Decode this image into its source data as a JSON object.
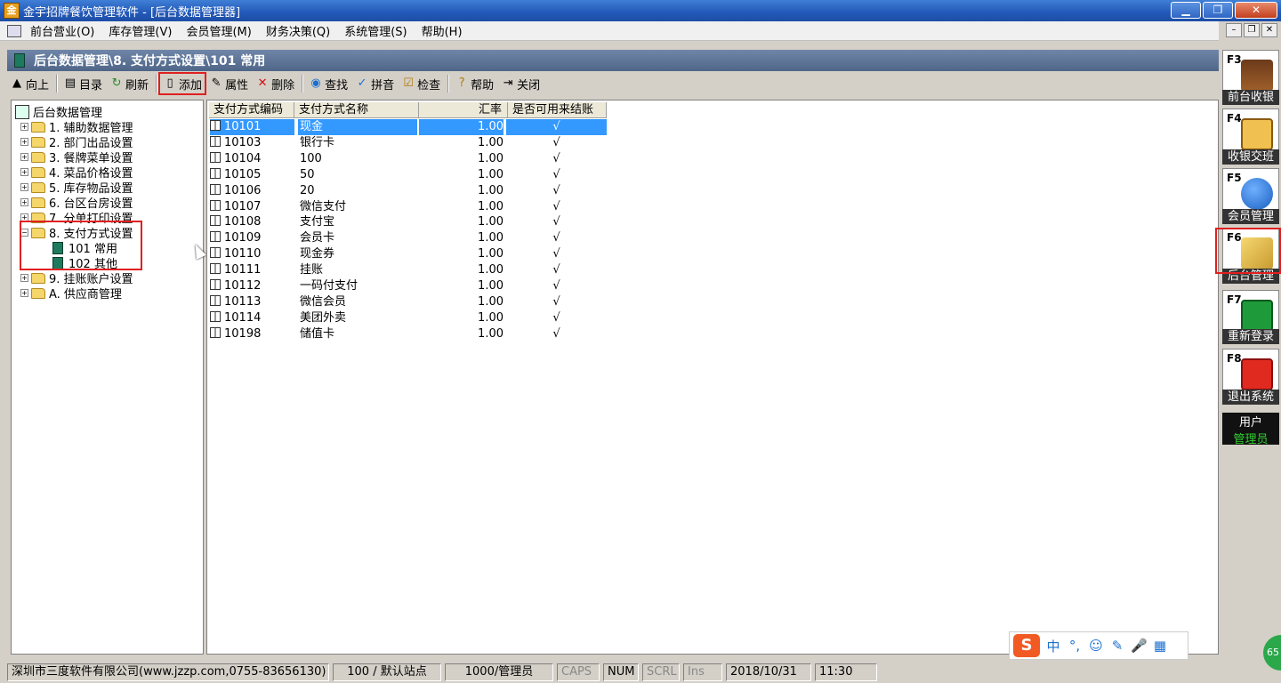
{
  "window": {
    "app_icon_text": "金",
    "title": "金宇招牌餐饮管理软件 - [后台数据管理器]",
    "min_label": "▁",
    "max_label": "❐",
    "close_label": "✕"
  },
  "menu": {
    "items": [
      "前台营业(O)",
      "库存管理(V)",
      "会员管理(M)",
      "财务决策(Q)",
      "系统管理(S)",
      "帮助(H)"
    ],
    "mdi_buttons": [
      "–",
      "❐",
      "✕"
    ]
  },
  "path": {
    "text": "后台数据管理\\8. 支付方式设置\\101 常用"
  },
  "toolbar": {
    "up": "向上",
    "dir": "目录",
    "refresh": "刷新",
    "add": "添加",
    "props": "属性",
    "delete": "删除",
    "find": "查找",
    "pinyin": "拼音",
    "check": "检查",
    "help": "帮助",
    "close": "关闭",
    "up_icon": "▲",
    "dir_icon": "▤",
    "refresh_icon": "↻",
    "add_icon": "▯",
    "props_icon": "✎",
    "delete_icon": "✕",
    "find_icon": "◉",
    "pinyin_icon": "✓",
    "check_icon": "☑",
    "help_icon": "?",
    "close_icon": "⇥"
  },
  "tree": {
    "root": "后台数据管理",
    "nodes": [
      "1. 辅助数据管理",
      "2. 部门出品设置",
      "3. 餐牌菜单设置",
      "4. 菜品价格设置",
      "5. 库存物品设置",
      "6. 台区台房设置",
      "7. 分单打印设置",
      "8. 支付方式设置",
      "9. 挂账账户设置",
      "A. 供应商管理"
    ],
    "children": [
      "101 常用",
      "102 其他"
    ],
    "collapsed_sign": "+",
    "expanded_sign": "−"
  },
  "grid": {
    "columns": [
      "支付方式编码",
      "支付方式名称",
      "汇率",
      "是否可用来结账"
    ],
    "rows": [
      [
        "10101",
        "现金",
        "1.00",
        "√"
      ],
      [
        "10103",
        "银行卡",
        "1.00",
        "√"
      ],
      [
        "10104",
        "100",
        "1.00",
        "√"
      ],
      [
        "10105",
        "50",
        "1.00",
        "√"
      ],
      [
        "10106",
        "20",
        "1.00",
        "√"
      ],
      [
        "10107",
        "微信支付",
        "1.00",
        "√"
      ],
      [
        "10108",
        "支付宝",
        "1.00",
        "√"
      ],
      [
        "10109",
        "会员卡",
        "1.00",
        "√"
      ],
      [
        "10110",
        "现金券",
        "1.00",
        "√"
      ],
      [
        "10111",
        "挂账",
        "1.00",
        "√"
      ],
      [
        "10112",
        "一码付支付",
        "1.00",
        "√"
      ],
      [
        "10113",
        "微信会员",
        "1.00",
        "√"
      ],
      [
        "10114",
        "美团外卖",
        "1.00",
        "√"
      ],
      [
        "10198",
        "储值卡",
        "1.00",
        "√"
      ]
    ]
  },
  "side": {
    "keys": [
      {
        "key": "F3",
        "label": "前台收银",
        "icon": "dining-table-icon",
        "color": "#ffffff"
      },
      {
        "key": "F4",
        "label": "收银交班",
        "icon": "clipboard-check-icon",
        "color": "#ffffff"
      },
      {
        "key": "F5",
        "label": "会员管理",
        "icon": "members-icon",
        "color": "#ffffff"
      },
      {
        "key": "F6",
        "label": "后台管理",
        "icon": "tools-folder-icon",
        "color": "#ffffff"
      },
      {
        "key": "F7",
        "label": "重新登录",
        "icon": "hourglass-icon",
        "color": "#ffffff"
      },
      {
        "key": "F8",
        "label": "退出系统",
        "icon": "power-icon",
        "color": "#ffffff"
      }
    ],
    "user_title": "用户",
    "user_name": "管理员"
  },
  "ime": {
    "logo": "S",
    "items": [
      "中",
      "°,",
      "☺",
      "✎",
      "🎤",
      "▦"
    ]
  },
  "status": {
    "company": "深圳市三度软件有限公司(www.jzzp.com,0755-83656130)",
    "station": "100 / 默认站点",
    "operator": "1000/管理员",
    "caps": "CAPS",
    "num": "NUM",
    "scrl": "SCRL",
    "ins": "Ins",
    "date": "2018/10/31",
    "time": "11:30",
    "badge": "65"
  }
}
